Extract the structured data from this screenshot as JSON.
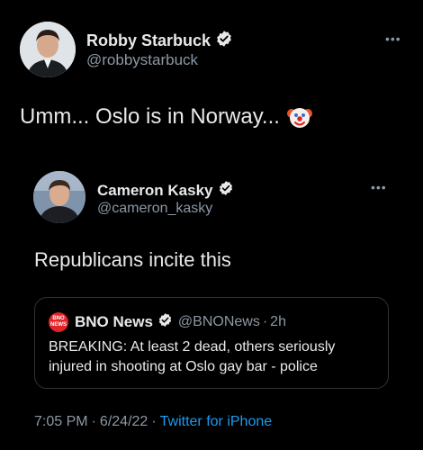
{
  "main_tweet": {
    "author_name": "Robby Starbuck",
    "author_handle": "@robbystarbuck",
    "text": "Umm... Oslo is in Norway...",
    "emoji_icon": "clown-face-icon",
    "more_icon": "more-dots-icon"
  },
  "quoted_tweet": {
    "author_name": "Cameron Kasky",
    "author_handle": "@cameron_kasky",
    "text": "Republicans incite this",
    "more_icon": "more-dots-icon"
  },
  "nested_quote": {
    "author_name": "BNO News",
    "author_handle": "@BNONews",
    "separator": "·",
    "time": "2h",
    "logo_text_top": "BNO",
    "logo_text_bottom": "NEWS",
    "text": "BREAKING: At least 2 dead, others seriously injured in shooting at Oslo gay bar - police"
  },
  "footer": {
    "time": "7:05 PM",
    "separator": "·",
    "date": "6/24/22",
    "source": "Twitter for iPhone"
  },
  "colors": {
    "background": "#000000",
    "text_primary": "#e7e9ea",
    "text_secondary": "#8b98a5",
    "verified_blue": "#1d9bf0",
    "link_blue": "#1d9bf0",
    "card_border": "#2f3336",
    "bno_red": "#e0242a"
  }
}
